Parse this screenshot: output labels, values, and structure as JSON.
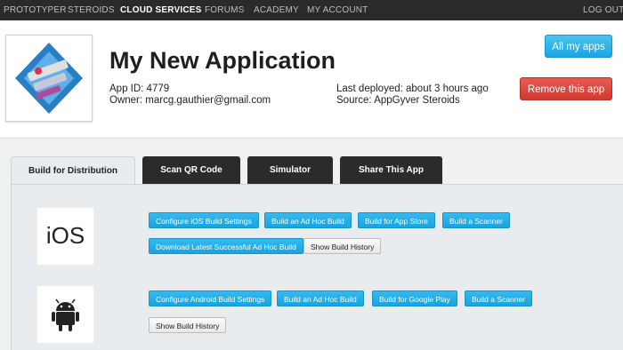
{
  "nav": {
    "items": [
      {
        "label": "PROTOTYPER"
      },
      {
        "label": "STEROIDS"
      },
      {
        "label": "CLOUD SERVICES"
      },
      {
        "label": "FORUMS"
      },
      {
        "label": "ACADEMY"
      },
      {
        "label": "MY ACCOUNT"
      },
      {
        "label": "LOG OUT"
      }
    ]
  },
  "app": {
    "title": "My New Application",
    "app_id": "App ID: 4779",
    "owner": "Owner: marcg.gauthier@gmail.com",
    "last_deployed": "Last deployed: about 3 hours ago",
    "source": "Source: AppGyver Steroids"
  },
  "actions": {
    "all_apps": "All my apps",
    "remove": "Remove this app"
  },
  "tabs": [
    {
      "label": "Build for Distribution"
    },
    {
      "label": "Scan QR Code"
    },
    {
      "label": "Simulator"
    },
    {
      "label": "Share This App"
    }
  ],
  "ios": {
    "logo_text": "iOS",
    "buttons": [
      "Configure iOS Build Settings",
      "Build an Ad Hoc Build",
      "Build for App Store",
      "Build a Scanner",
      "Download Latest Successful Ad Hoc Build",
      "Show Build History"
    ]
  },
  "android": {
    "icon": "android-icon",
    "buttons": [
      "Configure Android Build Settings",
      "Build an Ad Hoc Build",
      "Build for Google Play",
      "Build a Scanner",
      "Show Build History"
    ]
  },
  "colors": {
    "nav_bg": "#2a2a2a",
    "primary_blue": "#1ba3df",
    "danger_red": "#cf3a30"
  }
}
